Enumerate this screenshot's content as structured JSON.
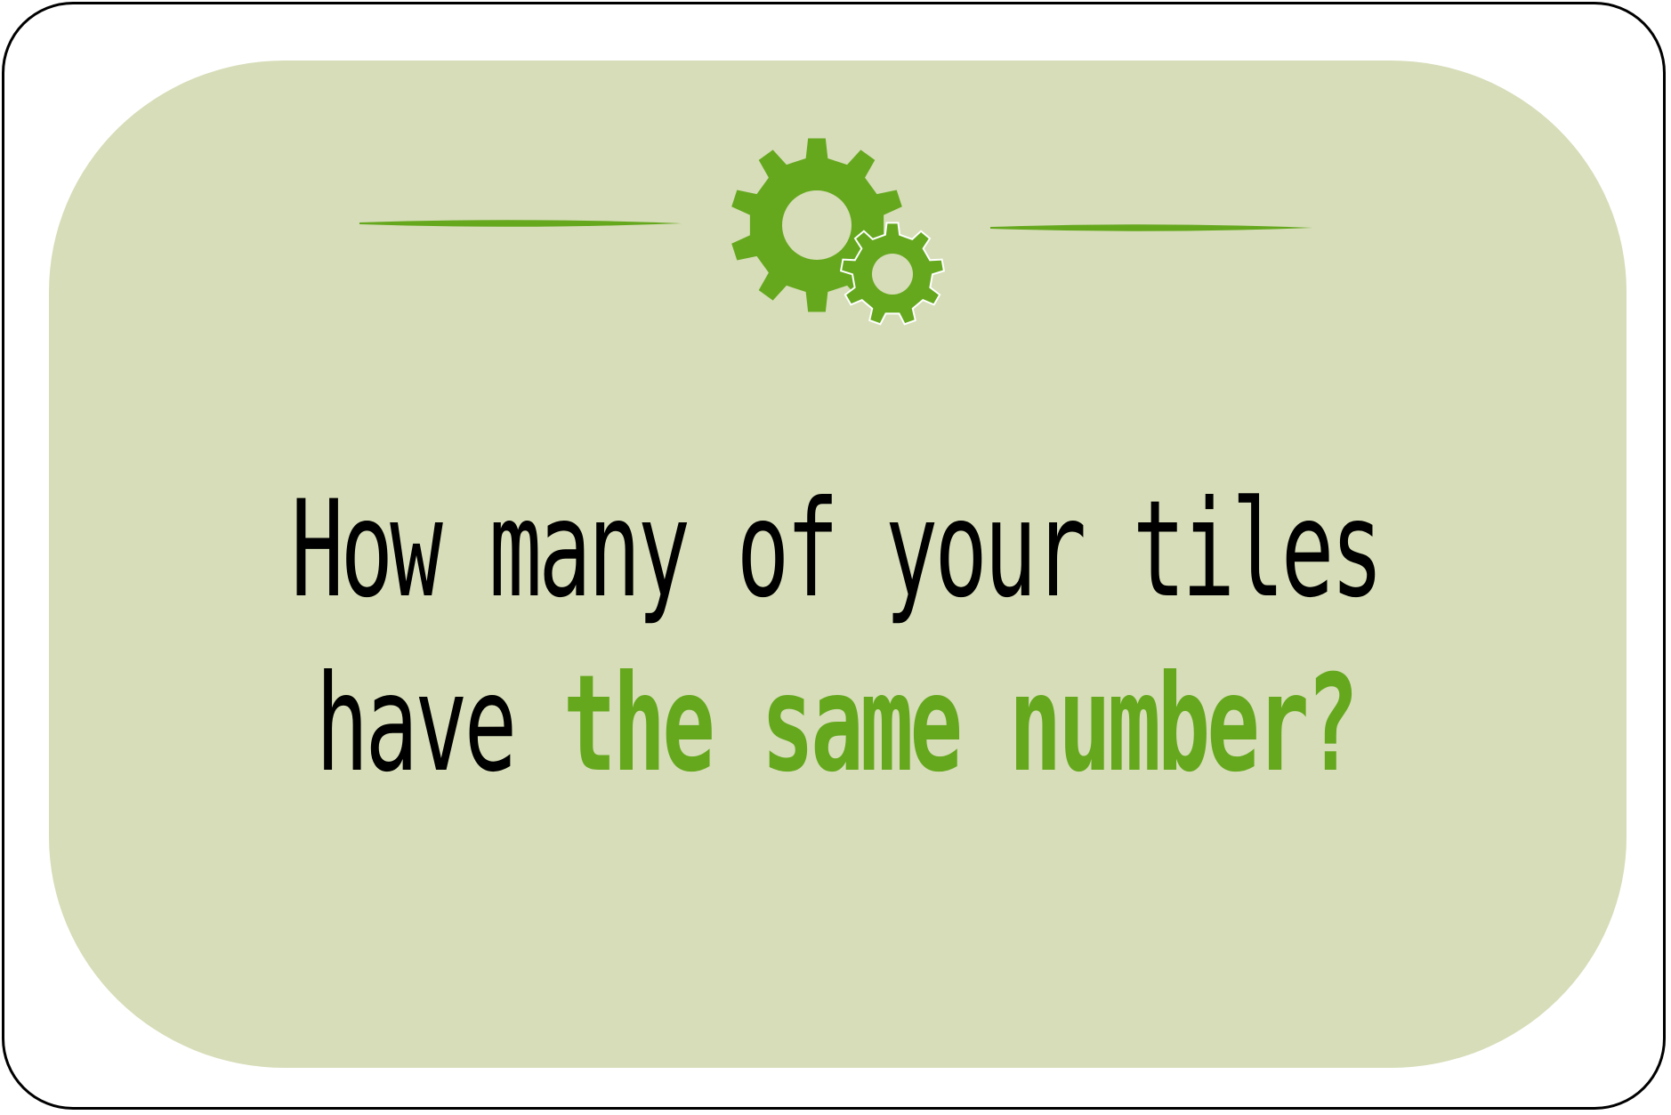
{
  "card": {
    "question_line1": "How many of your tiles",
    "question_line2_prefix": "have ",
    "question_line2_highlight": "the same number?"
  },
  "colors": {
    "panel": "#d6ddb8",
    "accent": "#65a81e",
    "text": "#000000",
    "frame": "#000000"
  },
  "icons": {
    "header": "gears-icon"
  }
}
